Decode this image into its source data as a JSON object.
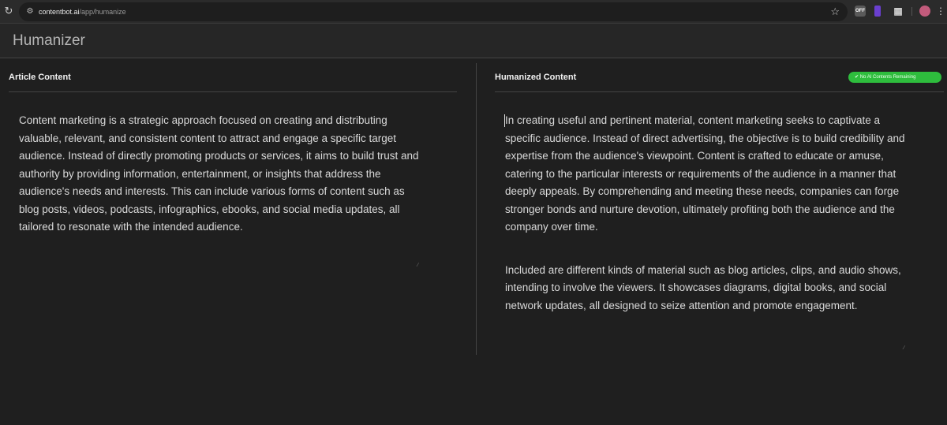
{
  "browser": {
    "url_host": "contentbot.ai",
    "url_path": "/app/humanize",
    "extension_off_label": "OFF"
  },
  "app": {
    "title": "Humanizer"
  },
  "left_panel": {
    "title": "Article Content",
    "text": "Content marketing is a strategic approach focused on creating and distributing valuable, relevant, and consistent content to attract and engage a specific target audience. Instead of directly promoting products or services, it aims to build trust and authority by providing information, entertainment, or insights that address the audience's needs and interests. This can include various forms of content such as blog posts, videos, podcasts, infographics, ebooks, and social media updates, all tailored to resonate with the intended audience."
  },
  "right_panel": {
    "title": "Humanized Content",
    "badge": "No AI Contents Remaining",
    "paragraphs": [
      "In creating useful and pertinent material, content marketing seeks to captivate a specific audience. Instead of direct advertising, the objective is to build credibility and expertise from the audience's viewpoint. Content is crafted to educate or amuse, catering to the particular interests or requirements of the audience in a manner that deeply appeals. By comprehending and meeting these needs, companies can forge stronger bonds and nurture devotion, ultimately profiting both the audience and the company over time.",
      "Included are different kinds of material such as blog articles, clips, and audio shows, intending to involve the viewers. It showcases diagrams, digital books, and social network updates, all designed to seize attention and promote engagement."
    ]
  },
  "colors": {
    "background": "#1f1f1f",
    "badge_green": "#2ebd3d",
    "text": "#d9d9d9"
  }
}
